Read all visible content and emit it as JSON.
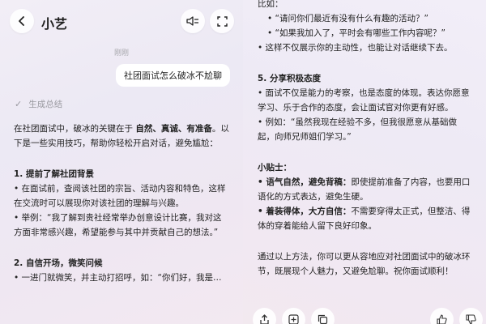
{
  "header": {
    "title": "小艺"
  },
  "chat": {
    "timestamp": "刚刚",
    "user_message": "社团面试怎么破冰不尬聊",
    "status": "生成总结"
  },
  "left_text": {
    "intro_1": "在社团面试中，破冰的关键在于",
    "intro_bold": "自然、真诚、有准备",
    "intro_2": "。以下是一些实用技巧，帮助你轻松开启对话，避免尴尬：",
    "s1_title": "1. 提前了解社团背景",
    "s1_b1": "• 在面试前，查阅该社团的宗旨、活动内容和特色，这样在交流时可以展现你对该社团的理解与兴趣。",
    "s1_b2": "• 举例：“我了解到贵社经常举办创意设计比赛，我对这方面非常感兴趣，希望能参与其中并贡献自己的想法。”",
    "s2_title": "2. 自信开场，微笑问候",
    "s2_b1": "• 一进门就微笑，并主动打招呼，如：“你们好，我是…"
  },
  "right_text": {
    "l1": "比如：",
    "l2": "• “请问你们最近有没有什么有趣的活动？”",
    "l3": "• “如果我加入了，平时会有哪些工作内容呢？”",
    "l4": "• 这样不仅展示你的主动性，也能让对话继续下去。",
    "s5_title": "5. 分享积极态度",
    "s5_b1": "• 面试不仅是能力的考察，也是态度的体现。表达你愿意学习、乐于合作的态度，会让面试官对你更有好感。",
    "s5_b2": "• 例如：“虽然我现在经验不多，但我很愿意从基础做起，向师兄师姐们学习。”",
    "tips_title": "小贴士：",
    "tip1_bold": "• 语气自然，避免背稿：",
    "tip1_text": "即使提前准备了内容，也要用口语化的方式表达，避免生硬。",
    "tip2_bold": "• 着装得体，大方自信：",
    "tip2_text": "不需要穿得太正式，但整洁、得体的穿着能给人留下良好印象。",
    "conclusion": "通过以上方法，你可以更从容地应对社团面试中的破冰环节，既展现个人魅力，又避免尬聊。祝你面试顺利！"
  },
  "icons": {
    "back": "chevron-left-icon",
    "sound": "speaker-mute-icon",
    "expand": "expand-icon",
    "actions": [
      "share-icon",
      "add-icon",
      "copy-icon",
      "thumb-up-icon",
      "thumb-down-icon"
    ]
  }
}
